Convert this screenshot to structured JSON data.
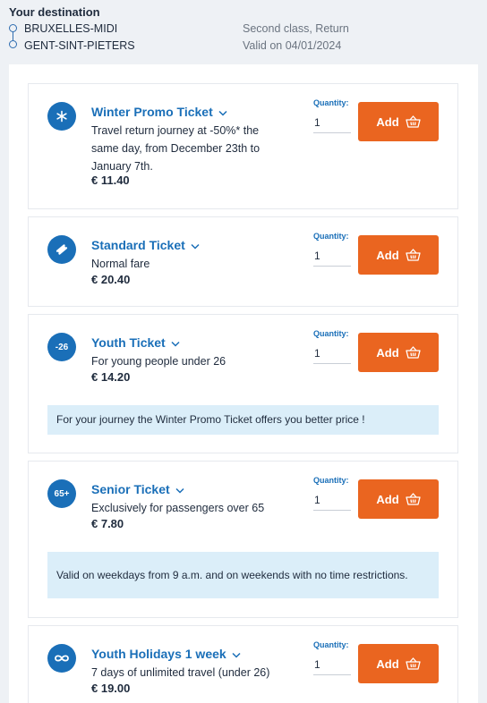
{
  "header": {
    "title": "Your destination",
    "origin": "BRUXELLES-MIDI",
    "destination": "GENT-SINT-PIETERS",
    "class_info": "Second class, Return",
    "validity": "Valid on 04/01/2024"
  },
  "tickets": [
    {
      "name": "Winter Promo Ticket",
      "icon": "snowflake-icon",
      "description": "Travel return journey at -50%* the same day, from December 23th to January 7th.",
      "price": "€ 11.40",
      "quantity_label": "Quantity:",
      "quantity": "1",
      "add_label": "Add"
    },
    {
      "name": "Standard Ticket",
      "icon": "ticket-icon",
      "description": "Normal fare",
      "price": "€ 20.40",
      "quantity_label": "Quantity:",
      "quantity": "1",
      "add_label": "Add"
    },
    {
      "name": "Youth Ticket",
      "icon": "age-badge-icon",
      "icon_text": "-26",
      "description": "For young people under 26",
      "price": "€ 14.20",
      "quantity_label": "Quantity:",
      "quantity": "1",
      "add_label": "Add",
      "note": "For your journey the Winter Promo Ticket offers you better price !"
    },
    {
      "name": "Senior Ticket",
      "icon": "age-badge-icon",
      "icon_text": "65+",
      "description": "Exclusively for passengers over 65",
      "price": "€ 7.80",
      "quantity_label": "Quantity:",
      "quantity": "1",
      "add_label": "Add",
      "note": "Valid on weekdays from 9 a.m. and on weekends with no time restrictions."
    },
    {
      "name": "Youth Holidays 1 week",
      "icon": "infinity-icon",
      "description": "7 days of unlimited travel (under 26)",
      "price": "€ 19.00",
      "quantity_label": "Quantity:",
      "quantity": "1",
      "add_label": "Add"
    }
  ],
  "colors": {
    "brand_blue": "#1a6fb8",
    "add_button": "#ea6520",
    "note_background": "#dbeef9",
    "page_background": "#eef1f5"
  }
}
